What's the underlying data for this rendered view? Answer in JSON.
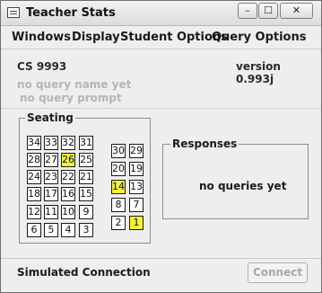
{
  "window": {
    "title": "Teacher Stats",
    "controls": {
      "minimize": "–",
      "maximize": "☐",
      "close": "✕"
    }
  },
  "menu": {
    "items": [
      "Windows",
      "Display",
      "Student Options",
      "Query Options"
    ]
  },
  "header": {
    "course": "CS 9993",
    "version": "version 0.993j",
    "query_name": "no query name yet",
    "query_prompt": "no query prompt"
  },
  "seating": {
    "label": "Seating",
    "highlight_color": "#f5f23a",
    "left_rows": [
      [
        "34",
        "33",
        "32",
        "31"
      ],
      [
        "28",
        "27",
        "26",
        "25"
      ],
      [
        "24",
        "23",
        "22",
        "21"
      ],
      [
        "18",
        "17",
        "16",
        "15"
      ],
      [
        "12",
        "11",
        "10",
        "9"
      ],
      [
        "6",
        "5",
        "4",
        "3"
      ]
    ],
    "right_rows": [
      [
        "30",
        "29"
      ],
      [
        "20",
        "19"
      ],
      [
        "14",
        "13"
      ],
      [
        "8",
        "7"
      ],
      [
        "2",
        "1"
      ]
    ],
    "highlighted": [
      "26",
      "14",
      "1"
    ]
  },
  "responses": {
    "label": "Responses",
    "empty_text": "no queries yet"
  },
  "footer": {
    "status": "Simulated Connection",
    "connect_label": "Connect"
  }
}
